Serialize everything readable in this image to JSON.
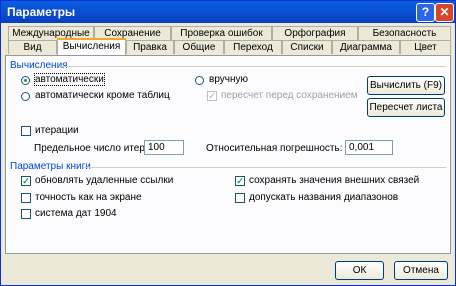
{
  "window": {
    "title": "Параметры",
    "help": "?",
    "close": "✕"
  },
  "tabs_row1": [
    "Международные",
    "Сохранение",
    "Проверка ошибок",
    "Орфография",
    "Безопасность"
  ],
  "tabs_row2": [
    "Вид",
    "Вычисления",
    "Правка",
    "Общие",
    "Переход",
    "Списки",
    "Диаграмма",
    "Цвет"
  ],
  "active_tab": "Вычисления",
  "calc": {
    "section": "Вычисления",
    "auto": "автоматически",
    "auto_except_tables": "автоматически кроме таблиц",
    "manual": "вручную",
    "recalc_before_save": "пересчет перед сохранением",
    "calc_now": "Вычислить (F9)",
    "calc_sheet": "Пересчет листа",
    "iterations": "итерации",
    "max_iter_label": "Предельное число итераций:",
    "max_iter_value": "100",
    "max_change_label": "Относительная погрешность:",
    "max_change_value": "0,001"
  },
  "workbook": {
    "section": "Параметры книги",
    "update_links": "обновлять удаленные ссылки",
    "precision_as_displayed": "точность как на экране",
    "date_1904": "система дат 1904",
    "save_external_values": "сохранять значения внешних связей",
    "accept_labels": "допускать названия диапазонов"
  },
  "buttons": {
    "ok": "ОК",
    "cancel": "Отмена"
  }
}
